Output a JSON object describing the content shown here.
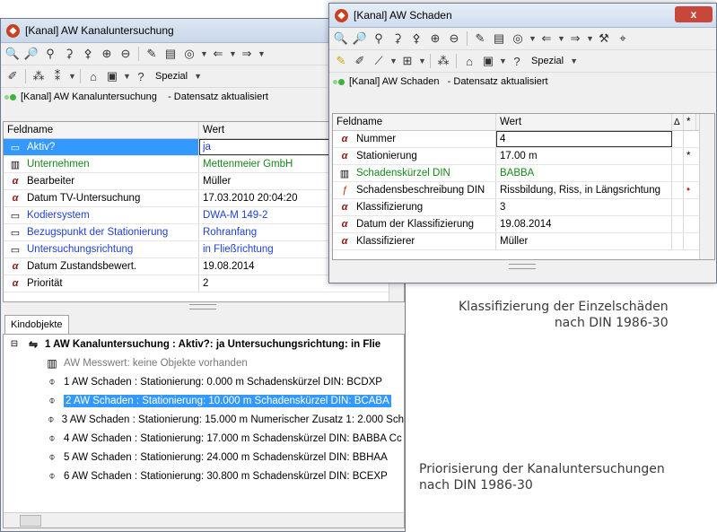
{
  "win1": {
    "title": "[Kanal] AW Kanaluntersuchung",
    "status": "[Kanal] AW Kanaluntersuchung    - Datensatz aktualisiert",
    "spezial": "Spezial",
    "grid": {
      "col_name": "Feldname",
      "col_value": "Wert",
      "rows": [
        {
          "icon": "table-icon",
          "name": "Aktiv?",
          "value": "ja",
          "style": "selected"
        },
        {
          "icon": "book-icon",
          "name": "Unternehmen",
          "value": "Mettenmeier GmbH",
          "style": "green"
        },
        {
          "icon": "alpha-icon",
          "name": "Bearbeiter",
          "value": "Müller",
          "style": "normal"
        },
        {
          "icon": "alpha-icon",
          "name": "Datum TV-Untersuchung",
          "value": "17.03.2010 20:04:20",
          "style": "normal"
        },
        {
          "icon": "table-icon",
          "name": "Kodiersystem",
          "value": "DWA-M 149-2",
          "style": "blue"
        },
        {
          "icon": "table-icon",
          "name": "Bezugspunkt der Stationierung",
          "value": "Rohranfang",
          "style": "blue"
        },
        {
          "icon": "table-icon",
          "name": "Untersuchungsrichtung",
          "value": "in Fließrichtung",
          "style": "blue"
        },
        {
          "icon": "alpha-icon",
          "name": "Datum Zustandsbewert.",
          "value": "19.08.2014",
          "style": "normal"
        },
        {
          "icon": "alpha-icon",
          "name": "Priorität",
          "value": "2",
          "style": "normal"
        }
      ]
    },
    "tab": "Kindobjekte",
    "tree": {
      "root": "1 AW Kanaluntersuchung :  Aktiv?: ja Untersuchungsrichtung: in Flie",
      "items": [
        {
          "text": "AW Messwert: keine Objekte vorhanden",
          "style": "gray",
          "icon": "gauge-icon"
        },
        {
          "text": "1 AW Schaden :  Stationierung: 0.000 m Schadenskürzel DIN: BCDXP",
          "style": "normal",
          "icon": "damage-icon"
        },
        {
          "text": "2 AW Schaden :  Stationierung: 10.000 m Schadenskürzel DIN: BCABA",
          "style": "selected",
          "icon": "damage-icon"
        },
        {
          "text": "3 AW Schaden :  Stationierung: 15.000 m Numerischer Zusatz 1: 2.000 Sch",
          "style": "normal",
          "icon": "damage-icon"
        },
        {
          "text": "4 AW Schaden :  Stationierung: 17.000 m Schadenskürzel DIN: BABBA Cc",
          "style": "normal",
          "icon": "damage-icon"
        },
        {
          "text": "5 AW Schaden :  Stationierung: 24.000 m Schadenskürzel DIN: BBHAA",
          "style": "normal",
          "icon": "damage-icon"
        },
        {
          "text": "6 AW Schaden :  Stationierung: 30.800 m Schadenskürzel DIN: BCEXP",
          "style": "normal",
          "icon": "damage-icon"
        }
      ]
    }
  },
  "win2": {
    "title": "[Kanal] AW Schaden",
    "close": "x",
    "status": "[Kanal] AW Schaden   - Datensatz aktualisiert",
    "spezial": "Spezial",
    "grid": {
      "col_name": "Feldname",
      "col_value": "Wert",
      "col_delta": "Δ",
      "col_star": "*",
      "rows": [
        {
          "icon": "alpha-icon",
          "name": "Nummer",
          "value": "4",
          "style": "edit",
          "mark": ""
        },
        {
          "icon": "alpha-icon",
          "name": "Stationierung",
          "value": "17.00 m",
          "style": "normal",
          "mark": "*"
        },
        {
          "icon": "book-icon",
          "name": "Schadenskürzel DIN",
          "value": "BABBA",
          "style": "green",
          "mark": ""
        },
        {
          "icon": "fx-icon",
          "name": "Schadensbeschreibung DIN",
          "value": "Rissbildung, Riss, in Längsrichtung",
          "style": "normal",
          "mark": "•"
        },
        {
          "icon": "alpha-icon",
          "name": "Klassifizierung",
          "value": "3",
          "style": "normal",
          "mark": ""
        },
        {
          "icon": "alpha-icon",
          "name": "Datum der Klassifizierung",
          "value": "19.08.2014",
          "style": "normal",
          "mark": ""
        },
        {
          "icon": "alpha-icon",
          "name": "Klassifizierer",
          "value": "Müller",
          "style": "normal",
          "mark": ""
        }
      ]
    }
  },
  "captions": {
    "right_top_1": "Klassifizierung der Einzelschäden",
    "right_top_2": "nach DIN 1986-30",
    "right_bottom_1": "Priorisierung der Kanaluntersuchungen",
    "right_bottom_2": "nach DIN 1986-30"
  }
}
